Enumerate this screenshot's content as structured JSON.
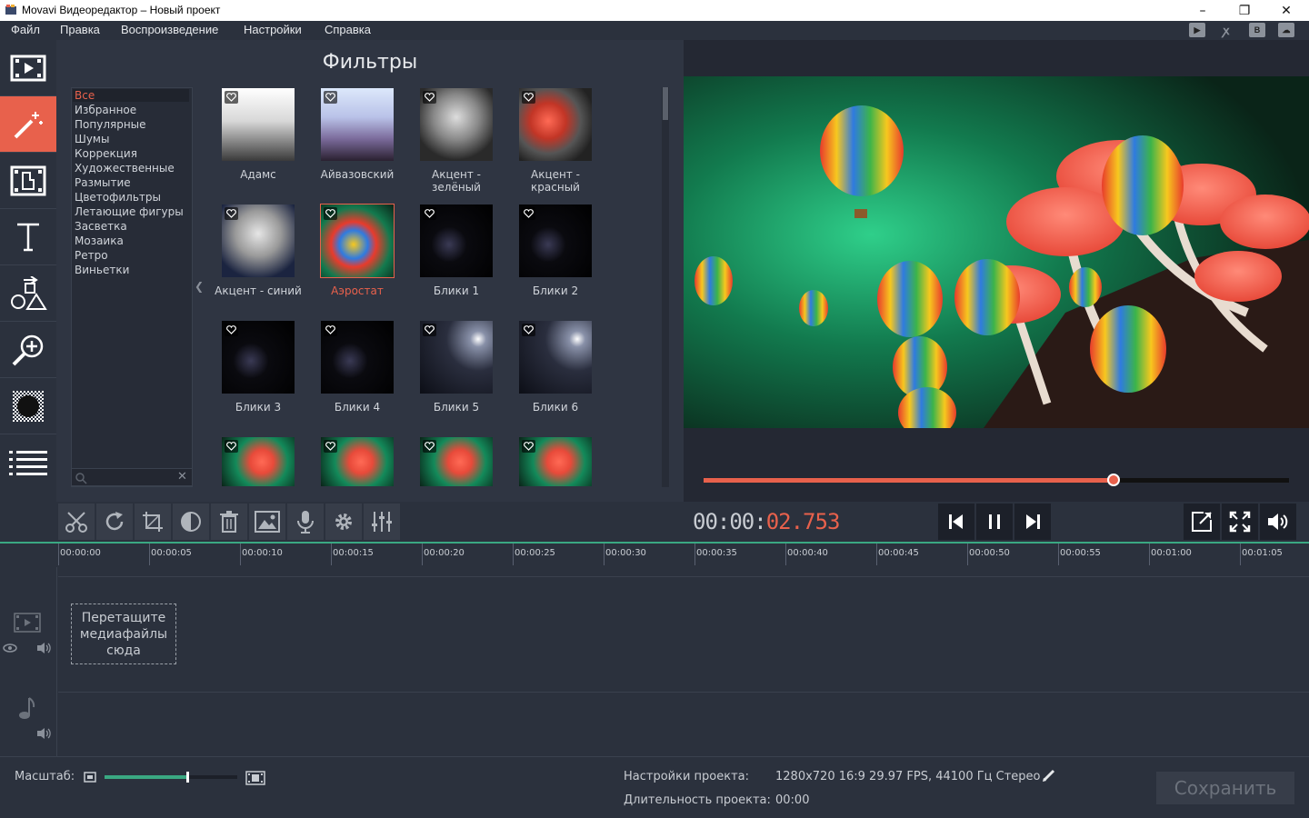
{
  "window": {
    "title": "Movavi Видеоредактор – Новый проект",
    "minimize": "–",
    "maximize": "❐",
    "close": "✕"
  },
  "menu": [
    "Файл",
    "Правка",
    "Воспроизведение",
    "Настройки",
    "Справка"
  ],
  "social_icons": [
    "youtube-icon",
    "odnoklassniki-icon",
    "vkontakte-icon",
    "cloud-upload-icon"
  ],
  "tools": [
    {
      "name": "import-media",
      "icon": "filmstrip-icon",
      "active": false
    },
    {
      "name": "filters",
      "icon": "magic-wand-icon",
      "active": true
    },
    {
      "name": "transitions",
      "icon": "transition-icon",
      "active": false
    },
    {
      "name": "titles",
      "icon": "text-icon",
      "active": false
    },
    {
      "name": "stickers",
      "icon": "shapes-icon",
      "active": false
    },
    {
      "name": "zoom-pan",
      "icon": "zoom-in-icon",
      "active": false
    },
    {
      "name": "chroma",
      "icon": "checker-icon",
      "active": false
    },
    {
      "name": "more",
      "icon": "list-icon",
      "active": false
    }
  ],
  "filters_panel": {
    "heading": "Фильтры",
    "categories": [
      "Все",
      "Избранное",
      "Популярные",
      "Шумы",
      "Коррекция",
      "Художественные",
      "Размытие",
      "Цветофильтры",
      "Летающие фигуры",
      "Засветка",
      "Мозаика",
      "Ретро",
      "Виньетки"
    ],
    "selected_category": "Все",
    "collapse_glyph": "❮",
    "search_clear": "✕",
    "items": [
      {
        "label": "Адамс",
        "style": "gray-gradient"
      },
      {
        "label": "Айвазовский",
        "style": "lavender-gradient"
      },
      {
        "label": "Акцент - зелёный",
        "style": "mono-green"
      },
      {
        "label": "Акцент - красный",
        "style": "mono-red"
      },
      {
        "label": "Акцент - синий",
        "style": "mono-blue"
      },
      {
        "label": "Аэростат",
        "style": "balloons",
        "selected": true
      },
      {
        "label": "Блики 1",
        "style": "flare"
      },
      {
        "label": "Блики 2",
        "style": "flare"
      },
      {
        "label": "Блики 3",
        "style": "flare"
      },
      {
        "label": "Блики 4",
        "style": "flare"
      },
      {
        "label": "Блики 5",
        "style": "flare-bright"
      },
      {
        "label": "Блики 6",
        "style": "flare-bright"
      },
      {
        "label": "",
        "style": "mushroom"
      },
      {
        "label": "",
        "style": "mushroom"
      },
      {
        "label": "",
        "style": "mushroom"
      },
      {
        "label": "",
        "style": "mushroom"
      }
    ]
  },
  "player": {
    "timecode_dim": "00:00:",
    "timecode_active": "02.753",
    "progress": 0.7
  },
  "edit_tools": [
    "scissors-icon",
    "rotate-icon",
    "crop-icon",
    "color-adjust-icon",
    "trash-icon",
    "image-icon",
    "microphone-icon",
    "gear-icon",
    "equalizer-icon"
  ],
  "transport": [
    "skip-back-icon",
    "pause-icon",
    "skip-forward-icon"
  ],
  "view_controls": [
    "export-icon",
    "fullscreen-icon",
    "volume-icon"
  ],
  "timeline": {
    "ruler": [
      "00:00:00",
      "00:00:05",
      "00:00:10",
      "00:00:15",
      "00:00:20",
      "00:00:25",
      "00:00:30",
      "00:00:35",
      "00:00:40",
      "00:00:45",
      "00:00:50",
      "00:00:55",
      "00:01:00",
      "00:01:05"
    ],
    "drop_hint": "Перетащите медиафайлы сюда"
  },
  "status": {
    "zoom_label": "Масштаб:",
    "zoom_level": 0.62,
    "settings_label": "Настройки проекта:",
    "settings_value": "1280x720 16:9 29.97 FPS, 44100 Гц Стерео",
    "duration_label": "Длительность проекта:",
    "duration_value": "00:00",
    "save_label": "Сохранить"
  },
  "colors": {
    "accent": "#e8614c",
    "panel": "#2b313d",
    "timeline_green": "#3aa882"
  }
}
